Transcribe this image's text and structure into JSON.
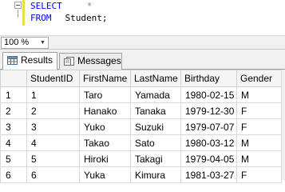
{
  "editor": {
    "line1": {
      "keyword": "SELECT",
      "operator": "*"
    },
    "line2": {
      "keyword": "FROM",
      "table": "Student;"
    }
  },
  "zoom": {
    "value": "100 %"
  },
  "tabs": [
    {
      "label": "Results",
      "active": true,
      "icon": "grid-icon"
    },
    {
      "label": "Messages",
      "active": false,
      "icon": "messages-icon"
    }
  ],
  "grid": {
    "columns": [
      "",
      "StudentID",
      "FirstName",
      "LastName",
      "Birthday",
      "Gender"
    ],
    "rows": [
      [
        "1",
        "1",
        "Taro",
        "Yamada",
        "1980-02-15",
        "M"
      ],
      [
        "2",
        "2",
        "Hanako",
        "Tanaka",
        "1979-12-30",
        "F"
      ],
      [
        "3",
        "3",
        "Yuko",
        "Suzuki",
        "1979-07-07",
        "F"
      ],
      [
        "4",
        "4",
        "Takao",
        "Sato",
        "1980-03-12",
        "M"
      ],
      [
        "5",
        "5",
        "Hiroki",
        "Takagi",
        "1979-04-05",
        "M"
      ],
      [
        "6",
        "6",
        "Yuka",
        "Kimura",
        "1981-03-27",
        "F"
      ]
    ]
  },
  "colors": {
    "keyword": "#0000ff",
    "operator": "#808080",
    "change_bar": "#ebdc3f"
  }
}
